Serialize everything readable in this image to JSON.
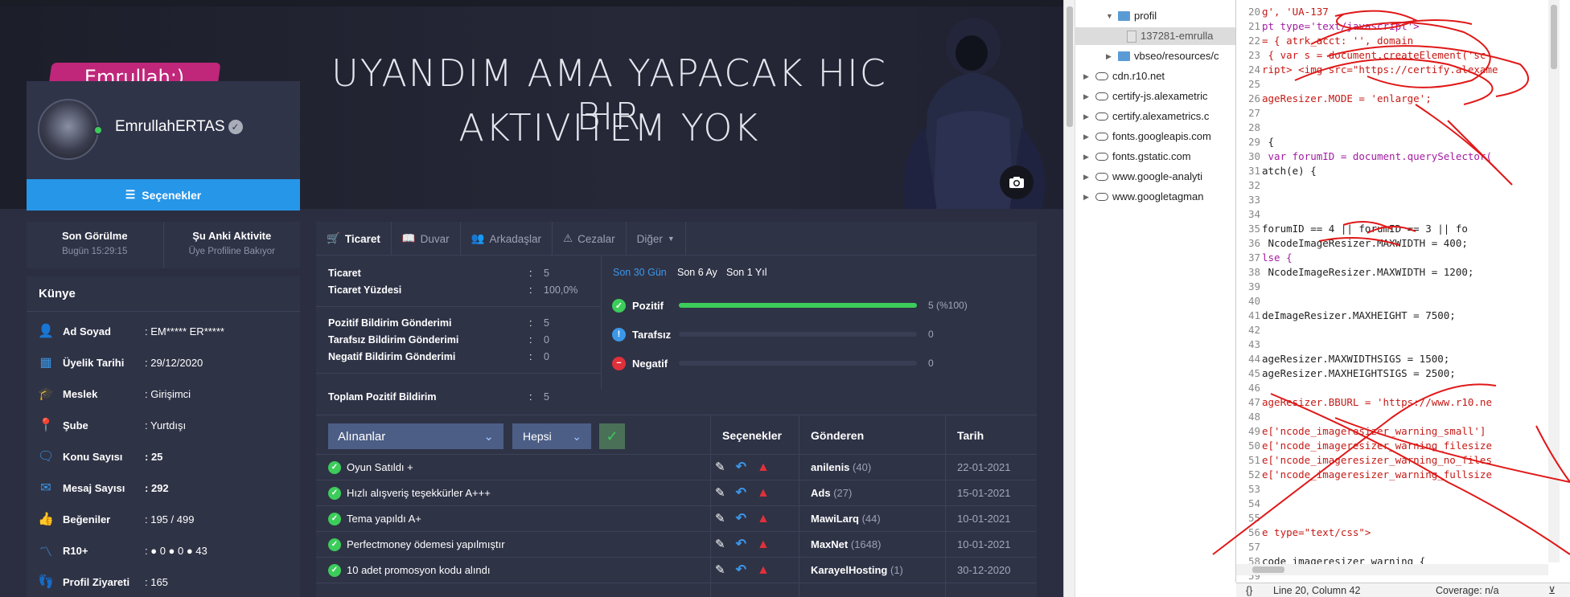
{
  "banner": {
    "line1": "UYANDIM AMA YAPACAK HIC BIR",
    "line2": "AKTIVITEM YOK",
    "logo_text": "Emrullah:)",
    "camera_icon": "camera-icon"
  },
  "profile": {
    "username": "EmrullahERTAS",
    "verified_icon": "verified-badge-icon",
    "options_label": "Seçenekler",
    "status_color": "#3ccc5a"
  },
  "lastseen": {
    "col1_title": "Son Görülme",
    "col1_value": "Bugün 15:29:15",
    "col2_title": "Şu Anki Aktivite",
    "col2_value": "Üye Profiline Bakıyor"
  },
  "kunye": {
    "title": "Künye",
    "rows": [
      {
        "icon": "user-icon",
        "label": "Ad Soyad",
        "value": ": EM***** ER*****"
      },
      {
        "icon": "calendar-icon",
        "label": "Üyelik Tarihi",
        "value": ": 29/12/2020"
      },
      {
        "icon": "graduation-cap-icon",
        "label": "Meslek",
        "value": ": Girişimci"
      },
      {
        "icon": "map-pin-icon",
        "label": "Şube",
        "value": ": Yurtdışı"
      },
      {
        "icon": "chat-icon",
        "label": "Konu Sayısı",
        "value": ": 25"
      },
      {
        "icon": "envelope-icon",
        "label": "Mesaj Sayısı",
        "value": ": 292"
      },
      {
        "icon": "thumbs-up-icon",
        "label": "Beğeniler",
        "value": ": 195 / 499"
      },
      {
        "icon": "trend-icon",
        "label": "R10+",
        "value": ": ● 0  ● 0  ● 43"
      },
      {
        "icon": "footsteps-icon",
        "label": "Profil Ziyareti",
        "value": ": 165"
      }
    ]
  },
  "tabs": [
    {
      "icon": "cart-icon",
      "label": "Ticaret"
    },
    {
      "icon": "book-icon",
      "label": "Duvar"
    },
    {
      "icon": "users-icon",
      "label": "Arkadaşlar"
    },
    {
      "icon": "warning-icon",
      "label": "Cezalar"
    },
    {
      "icon": "caret-down-icon",
      "label": "Diğer"
    }
  ],
  "stats": {
    "ticaret": {
      "label": "Ticaret",
      "value": "5"
    },
    "yuzde": {
      "label": "Ticaret Yüzdesi",
      "value": "100,0%"
    },
    "pozitif": {
      "label": "Pozitif Bildirim Gönderimi",
      "value": "5"
    },
    "tarafsiz": {
      "label": "Tarafsız Bildirim Gönderimi",
      "value": "0"
    },
    "negatif": {
      "label": "Negatif Bildirim Gönderimi",
      "value": "0"
    },
    "toplam": {
      "label": "Toplam Pozitif Bildirim",
      "value": "5"
    }
  },
  "periods": [
    "Son 30 Gün",
    "Son 6 Ay",
    "Son 1 Yıl"
  ],
  "graph": [
    {
      "label": "Pozitif",
      "value": "5 (%100)",
      "fraction": 1.0,
      "color": "#3ccc5a"
    },
    {
      "label": "Tarafsız",
      "value": "0",
      "fraction": 0,
      "color": "#3c97e8"
    },
    {
      "label": "Negatif",
      "value": "0",
      "fraction": 0,
      "color": "#e0303a"
    }
  ],
  "filters": {
    "select1": "Alınanlar",
    "select2": "Hepsi"
  },
  "table": {
    "headers": [
      "Seçenekler",
      "Gönderen",
      "Tarih"
    ],
    "rows": [
      {
        "subject": "Oyun Satıldı +",
        "sender": "anilenis",
        "count": "(40)",
        "date": "22-01-2021"
      },
      {
        "subject": "Hızlı alışveriş teşekkürler A+++",
        "sender": "Ads",
        "count": "(27)",
        "date": "15-01-2021"
      },
      {
        "subject": "Tema yapıldı A+",
        "sender": "MawiLarq",
        "count": "(44)",
        "date": "10-01-2021"
      },
      {
        "subject": "Perfectmoney ödemesi yapılmıştır",
        "sender": "MaxNet",
        "count": "(1648)",
        "date": "10-01-2021"
      },
      {
        "subject": "10 adet promosyon kodu alındı",
        "sender": "KarayelHosting",
        "count": "(1)",
        "date": "30-12-2020"
      }
    ]
  },
  "devtools": {
    "tree": [
      {
        "label": "profil",
        "type": "folder",
        "open": true
      },
      {
        "label": "137281-emrulla",
        "type": "file"
      },
      {
        "label": "vbseo/resources/c",
        "type": "folder",
        "open": false
      },
      {
        "label": "cdn.r10.net",
        "type": "cloud"
      },
      {
        "label": "certify-js.alexametric",
        "type": "cloud"
      },
      {
        "label": "certify.alexametrics.c",
        "type": "cloud"
      },
      {
        "label": "fonts.googleapis.com",
        "type": "cloud"
      },
      {
        "label": "fonts.gstatic.com",
        "type": "cloud"
      },
      {
        "label": "www.google-analyti",
        "type": "cloud"
      },
      {
        "label": "www.googletagman",
        "type": "cloud"
      }
    ],
    "code": [
      {
        "n": "20",
        "t": "g', 'UA-137"
      },
      {
        "n": "21",
        "t": "pt type='text/javascript'>"
      },
      {
        "n": "22",
        "t": "= { atrk_acct: '', domain"
      },
      {
        "n": "23",
        "t": " { var s = document.createElement('sc"
      },
      {
        "n": "24",
        "t": "ript> <img src=\"https://certify.alexame"
      },
      {
        "n": "25",
        "t": ""
      },
      {
        "n": "26",
        "t": "ageResizer.MODE = 'enlarge';"
      },
      {
        "n": "27",
        "t": ""
      },
      {
        "n": "28",
        "t": ""
      },
      {
        "n": "29",
        "t": " {"
      },
      {
        "n": "30",
        "t": " var forumID = document.querySelector("
      },
      {
        "n": "31",
        "t": "atch(e) {"
      },
      {
        "n": "32",
        "t": ""
      },
      {
        "n": "33",
        "t": ""
      },
      {
        "n": "34",
        "t": ""
      },
      {
        "n": "35",
        "t": "forumID == 4 || forumID == 3 || fo"
      },
      {
        "n": "36",
        "t": " NcodeImageResizer.MAXWIDTH = 400;"
      },
      {
        "n": "37",
        "t": "lse {"
      },
      {
        "n": "38",
        "t": " NcodeImageResizer.MAXWIDTH = 1200;"
      },
      {
        "n": "39",
        "t": ""
      },
      {
        "n": "40",
        "t": ""
      },
      {
        "n": "41",
        "t": "deImageResizer.MAXHEIGHT = 7500;"
      },
      {
        "n": "42",
        "t": ""
      },
      {
        "n": "43",
        "t": ""
      },
      {
        "n": "44",
        "t": "ageResizer.MAXWIDTHSIGS = 1500;"
      },
      {
        "n": "45",
        "t": "ageResizer.MAXHEIGHTSIGS = 2500;"
      },
      {
        "n": "46",
        "t": ""
      },
      {
        "n": "47",
        "t": "ageResizer.BBURL = 'https://www.r10.ne"
      },
      {
        "n": "48",
        "t": ""
      },
      {
        "n": "49",
        "t": "e['ncode_imageresizer_warning_small']"
      },
      {
        "n": "50",
        "t": "e['ncode_imageresizer_warning_filesize"
      },
      {
        "n": "51",
        "t": "e['ncode_imageresizer_warning_no_files"
      },
      {
        "n": "52",
        "t": "e['ncode_imageresizer_warning_fullsize"
      },
      {
        "n": "53",
        "t": ""
      },
      {
        "n": "54",
        "t": ""
      },
      {
        "n": "55",
        "t": ""
      },
      {
        "n": "56",
        "t": "e type=\"text/css\">"
      },
      {
        "n": "57",
        "t": ""
      },
      {
        "n": "58",
        "t": "code_imageresizer_warning {"
      },
      {
        "n": "59",
        "t": ""
      }
    ],
    "status_brace": "{}",
    "status_position": "Line 20, Column 42",
    "status_coverage": "Coverage: n/a"
  }
}
